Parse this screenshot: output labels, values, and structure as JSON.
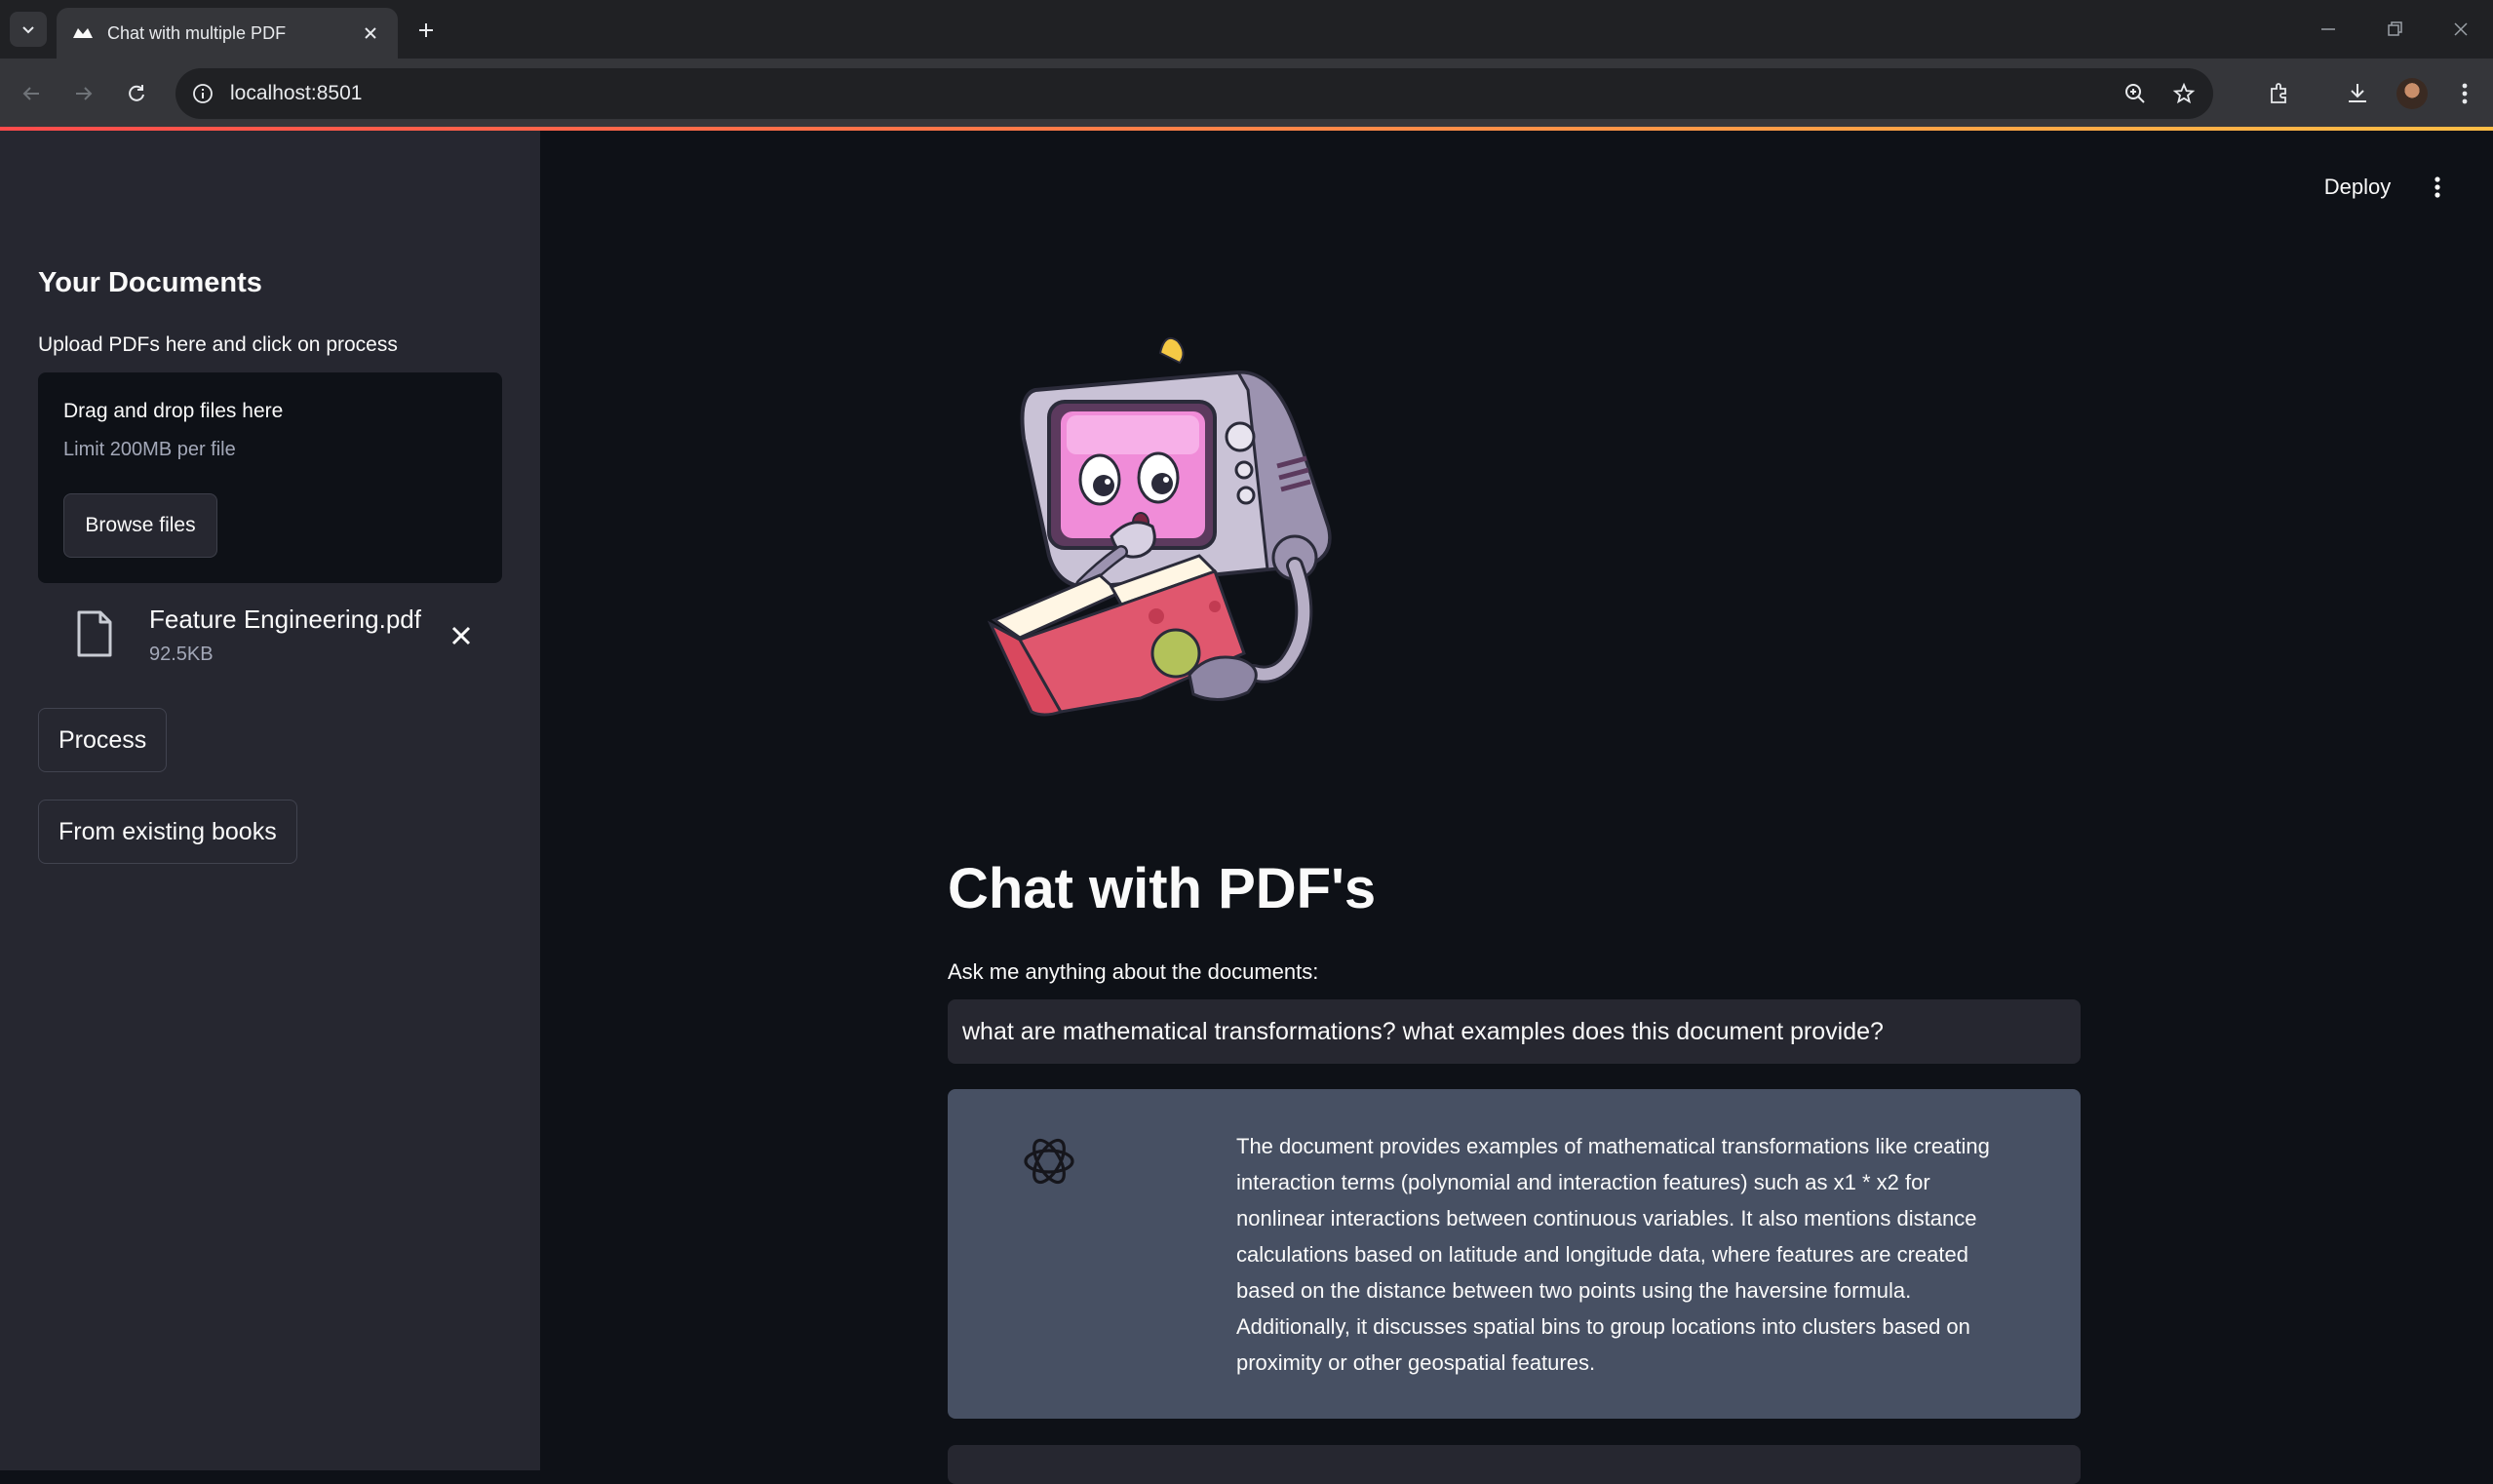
{
  "browser": {
    "tab_title": "Chat with multiple PDF",
    "url": "localhost:8501"
  },
  "header": {
    "deploy_label": "Deploy"
  },
  "sidebar": {
    "heading": "Your Documents",
    "upload_label": "Upload PDFs here and click on process",
    "dropzone_title": "Drag and drop files here",
    "dropzone_limit": "Limit 200MB per file",
    "browse_label": "Browse files",
    "file": {
      "name": "Feature Engineering.pdf",
      "size": "92.5KB"
    },
    "process_label": "Process",
    "existing_label": "From existing books"
  },
  "main": {
    "title": "Chat with PDF's",
    "question_label": "Ask me anything about the documents:",
    "question_value": "what are mathematical transformations? what examples does this document provide?",
    "answer": "The document provides examples of mathematical transformations like creating interaction terms (polynomial and interaction features) such as x1 * x2 for nonlinear interactions between continuous variables. It also mentions distance calculations based on latitude and longitude data, where features are created based on the distance between two points using the haversine formula. Additionally, it discusses spatial bins to group locations into clusters based on proximity or other geospatial features."
  },
  "colors": {
    "app_background": "#0e1117",
    "sidebar_background": "#262730",
    "answer_card": "#475063",
    "accent_gradient_start": "#ff4b4b",
    "accent_gradient_end": "#ffbd45"
  }
}
